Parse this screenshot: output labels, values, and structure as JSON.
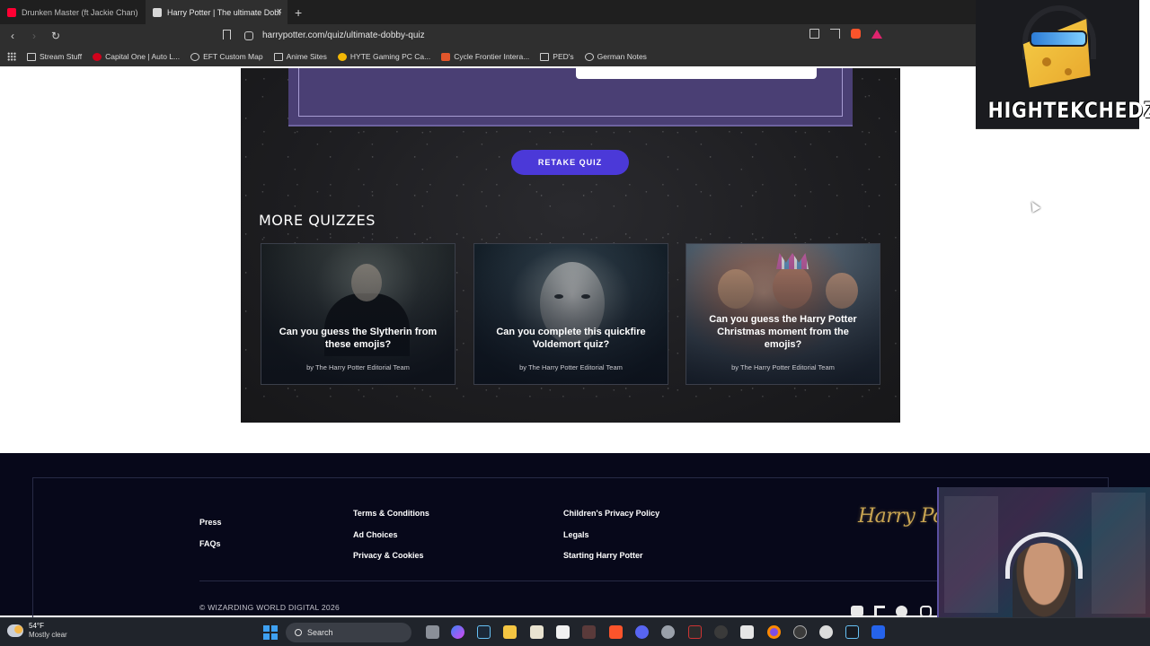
{
  "browser": {
    "tabs": [
      {
        "title": "Drunken Master (ft Jackie Chan) | Fu",
        "favicon_color": "#ff0033",
        "active": false
      },
      {
        "title": "Harry Potter | The ultimate Dobb",
        "favicon_color": "#d8d8d8",
        "active": true
      }
    ],
    "new_tab_label": "+",
    "close_label": "×",
    "url": "harrypotter.com/quiz/ultimate-dobby-quiz",
    "bookmarks": [
      {
        "label": "Stream Stuff",
        "icon": "folder-icon"
      },
      {
        "label": "Capital One | Auto L...",
        "icon": "capital-one-icon"
      },
      {
        "label": "EFT Custom Map",
        "icon": "globe-icon"
      },
      {
        "label": "Anime Sites",
        "icon": "folder-icon"
      },
      {
        "label": "HYTE Gaming PC Ca...",
        "icon": "hyte-icon"
      },
      {
        "label": "Cycle Frontier Intera...",
        "icon": "cycle-icon"
      },
      {
        "label": "PED's",
        "icon": "folder-icon"
      },
      {
        "label": "German Notes",
        "icon": "globe-icon"
      }
    ]
  },
  "quiz": {
    "retake_label": "RETAKE QUIZ",
    "more_title": "MORE QUIZZES",
    "cards": [
      {
        "title": "Can you guess the Slytherin from these emojis?",
        "author": "by The Harry Potter Editorial Team"
      },
      {
        "title": "Can you complete this quickfire Voldemort quiz?",
        "author": "by The Harry Potter Editorial Team"
      },
      {
        "title": "Can you guess the Harry Potter Christmas moment from the emojis?",
        "author": "by The Harry Potter Editorial Team"
      }
    ]
  },
  "footer": {
    "col1": [
      "Press",
      "FAQs"
    ],
    "col2": [
      "Terms & Conditions",
      "Ad Choices",
      "Privacy & Cookies"
    ],
    "col3": [
      "Children's Privacy Policy",
      "Legals",
      "Starting Harry Potter"
    ],
    "logo_text": "Harry Potte",
    "copyright": "© WIZARDING WORLD DIGITAL 2026",
    "social": [
      "youtube-icon",
      "tiktok-icon",
      "facebook-icon",
      "instagram-icon"
    ]
  },
  "taskbar": {
    "temperature": "54°F",
    "condition": "Mostly clear",
    "search_label": "Search"
  },
  "overlay": {
    "brand_name": "HIGHTEKCHEDZ"
  },
  "colors": {
    "accent": "#4b39d8",
    "footer_bg": "#07081a",
    "result_box": "#4a3f74",
    "logo_gold": "#c9a552"
  }
}
